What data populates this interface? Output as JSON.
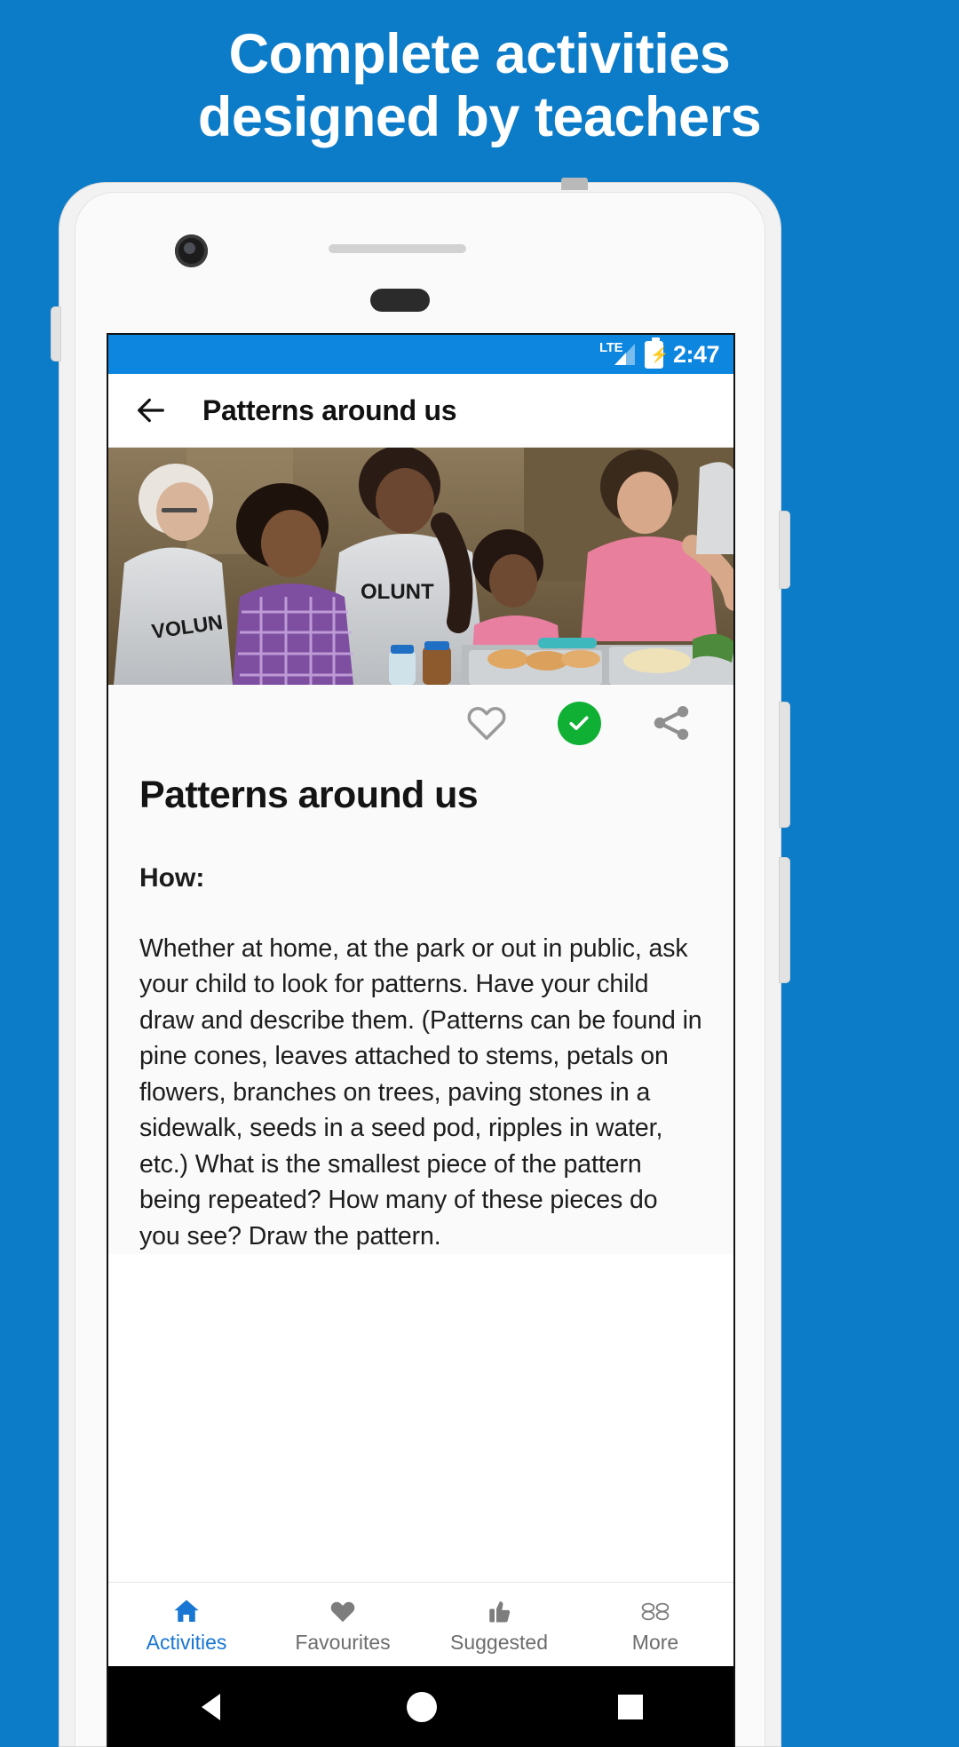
{
  "promo": {
    "headline_line1": "Complete activities",
    "headline_line2": "designed by teachers",
    "background_color": "#0d7cc8",
    "headline_color": "#ffffff"
  },
  "status_bar": {
    "network_label": "LTE",
    "time": "2:47",
    "battery_state": "charging",
    "background_color": "#0d86e0"
  },
  "app_bar": {
    "back_icon": "arrow-left-icon",
    "title": "Patterns around us"
  },
  "hero": {
    "image_alt": "Volunteers serving food at a community meal"
  },
  "actions": [
    {
      "name": "favourite",
      "icon": "heart-outline-icon",
      "state": "off",
      "color": "#9a9a9a"
    },
    {
      "name": "complete",
      "icon": "check-circle-icon",
      "state": "on",
      "color": "#10b034"
    },
    {
      "name": "share",
      "icon": "share-icon",
      "state": "off",
      "color": "#8f8f8f"
    }
  ],
  "activity": {
    "title": "Patterns around us",
    "how_label": "How:",
    "description": "Whether at home, at the park or out in public, ask your child to look for patterns. Have your child draw and describe them. (Patterns can be found in pine cones, leaves attached to stems, petals on flowers, branches on trees, paving stones in a sidewalk, seeds in a seed pod, ripples in water, etc.) What is the smallest piece of the pattern being repeated? How many of these pieces do you see? Draw the pattern."
  },
  "bottom_nav": {
    "active_color": "#1976d2",
    "inactive_color": "#6d6d6d",
    "items": [
      {
        "label": "Activities",
        "icon": "home-icon",
        "active": true
      },
      {
        "label": "Favourites",
        "icon": "heart-filled-icon",
        "active": false
      },
      {
        "label": "Suggested",
        "icon": "thumb-up-icon",
        "active": false
      },
      {
        "label": "More",
        "icon": "more-icon",
        "active": false
      }
    ]
  },
  "soft_keys": [
    {
      "name": "back",
      "icon": "triangle-back-icon"
    },
    {
      "name": "home",
      "icon": "circle-home-icon"
    },
    {
      "name": "recents",
      "icon": "square-recents-icon"
    }
  ]
}
